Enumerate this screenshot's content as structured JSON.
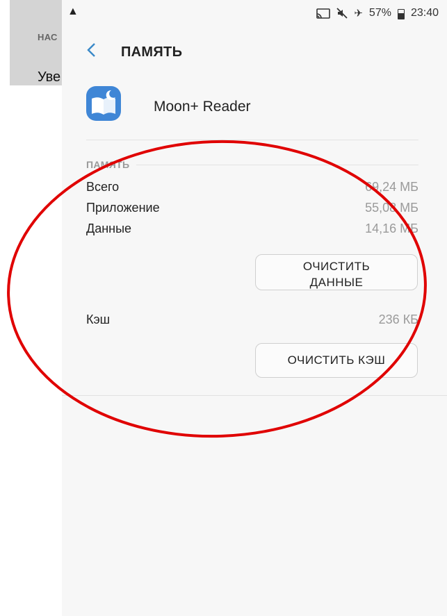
{
  "background_app": {
    "section_label": "НАС",
    "item_label": "Уве"
  },
  "statusbar": {
    "battery_percent": "57%",
    "time": "23:40",
    "icons": [
      "warning-icon",
      "cast-icon",
      "mute-icon",
      "airplane-icon",
      "battery-icon"
    ]
  },
  "appbar": {
    "title": "ПАМЯТЬ"
  },
  "app": {
    "name": "Moon+ Reader",
    "icon": "moon-reader-book-icon"
  },
  "storage": {
    "section_label": "ПАМЯТЬ",
    "rows": [
      {
        "label": "Всего",
        "value": "69,24 МБ"
      },
      {
        "label": "Приложение",
        "value": "55,08 МБ"
      },
      {
        "label": "Данные",
        "value": "14,16 МБ"
      }
    ],
    "clear_data_line1": "ОЧИСТИТЬ",
    "clear_data_line2": "ДАННЫЕ"
  },
  "cache": {
    "label": "Кэш",
    "value": "236 КБ",
    "clear_cache_label": "ОЧИСТИТЬ КЭШ"
  },
  "colors": {
    "accent": "#3a89c8",
    "annotation": "#e00000"
  }
}
